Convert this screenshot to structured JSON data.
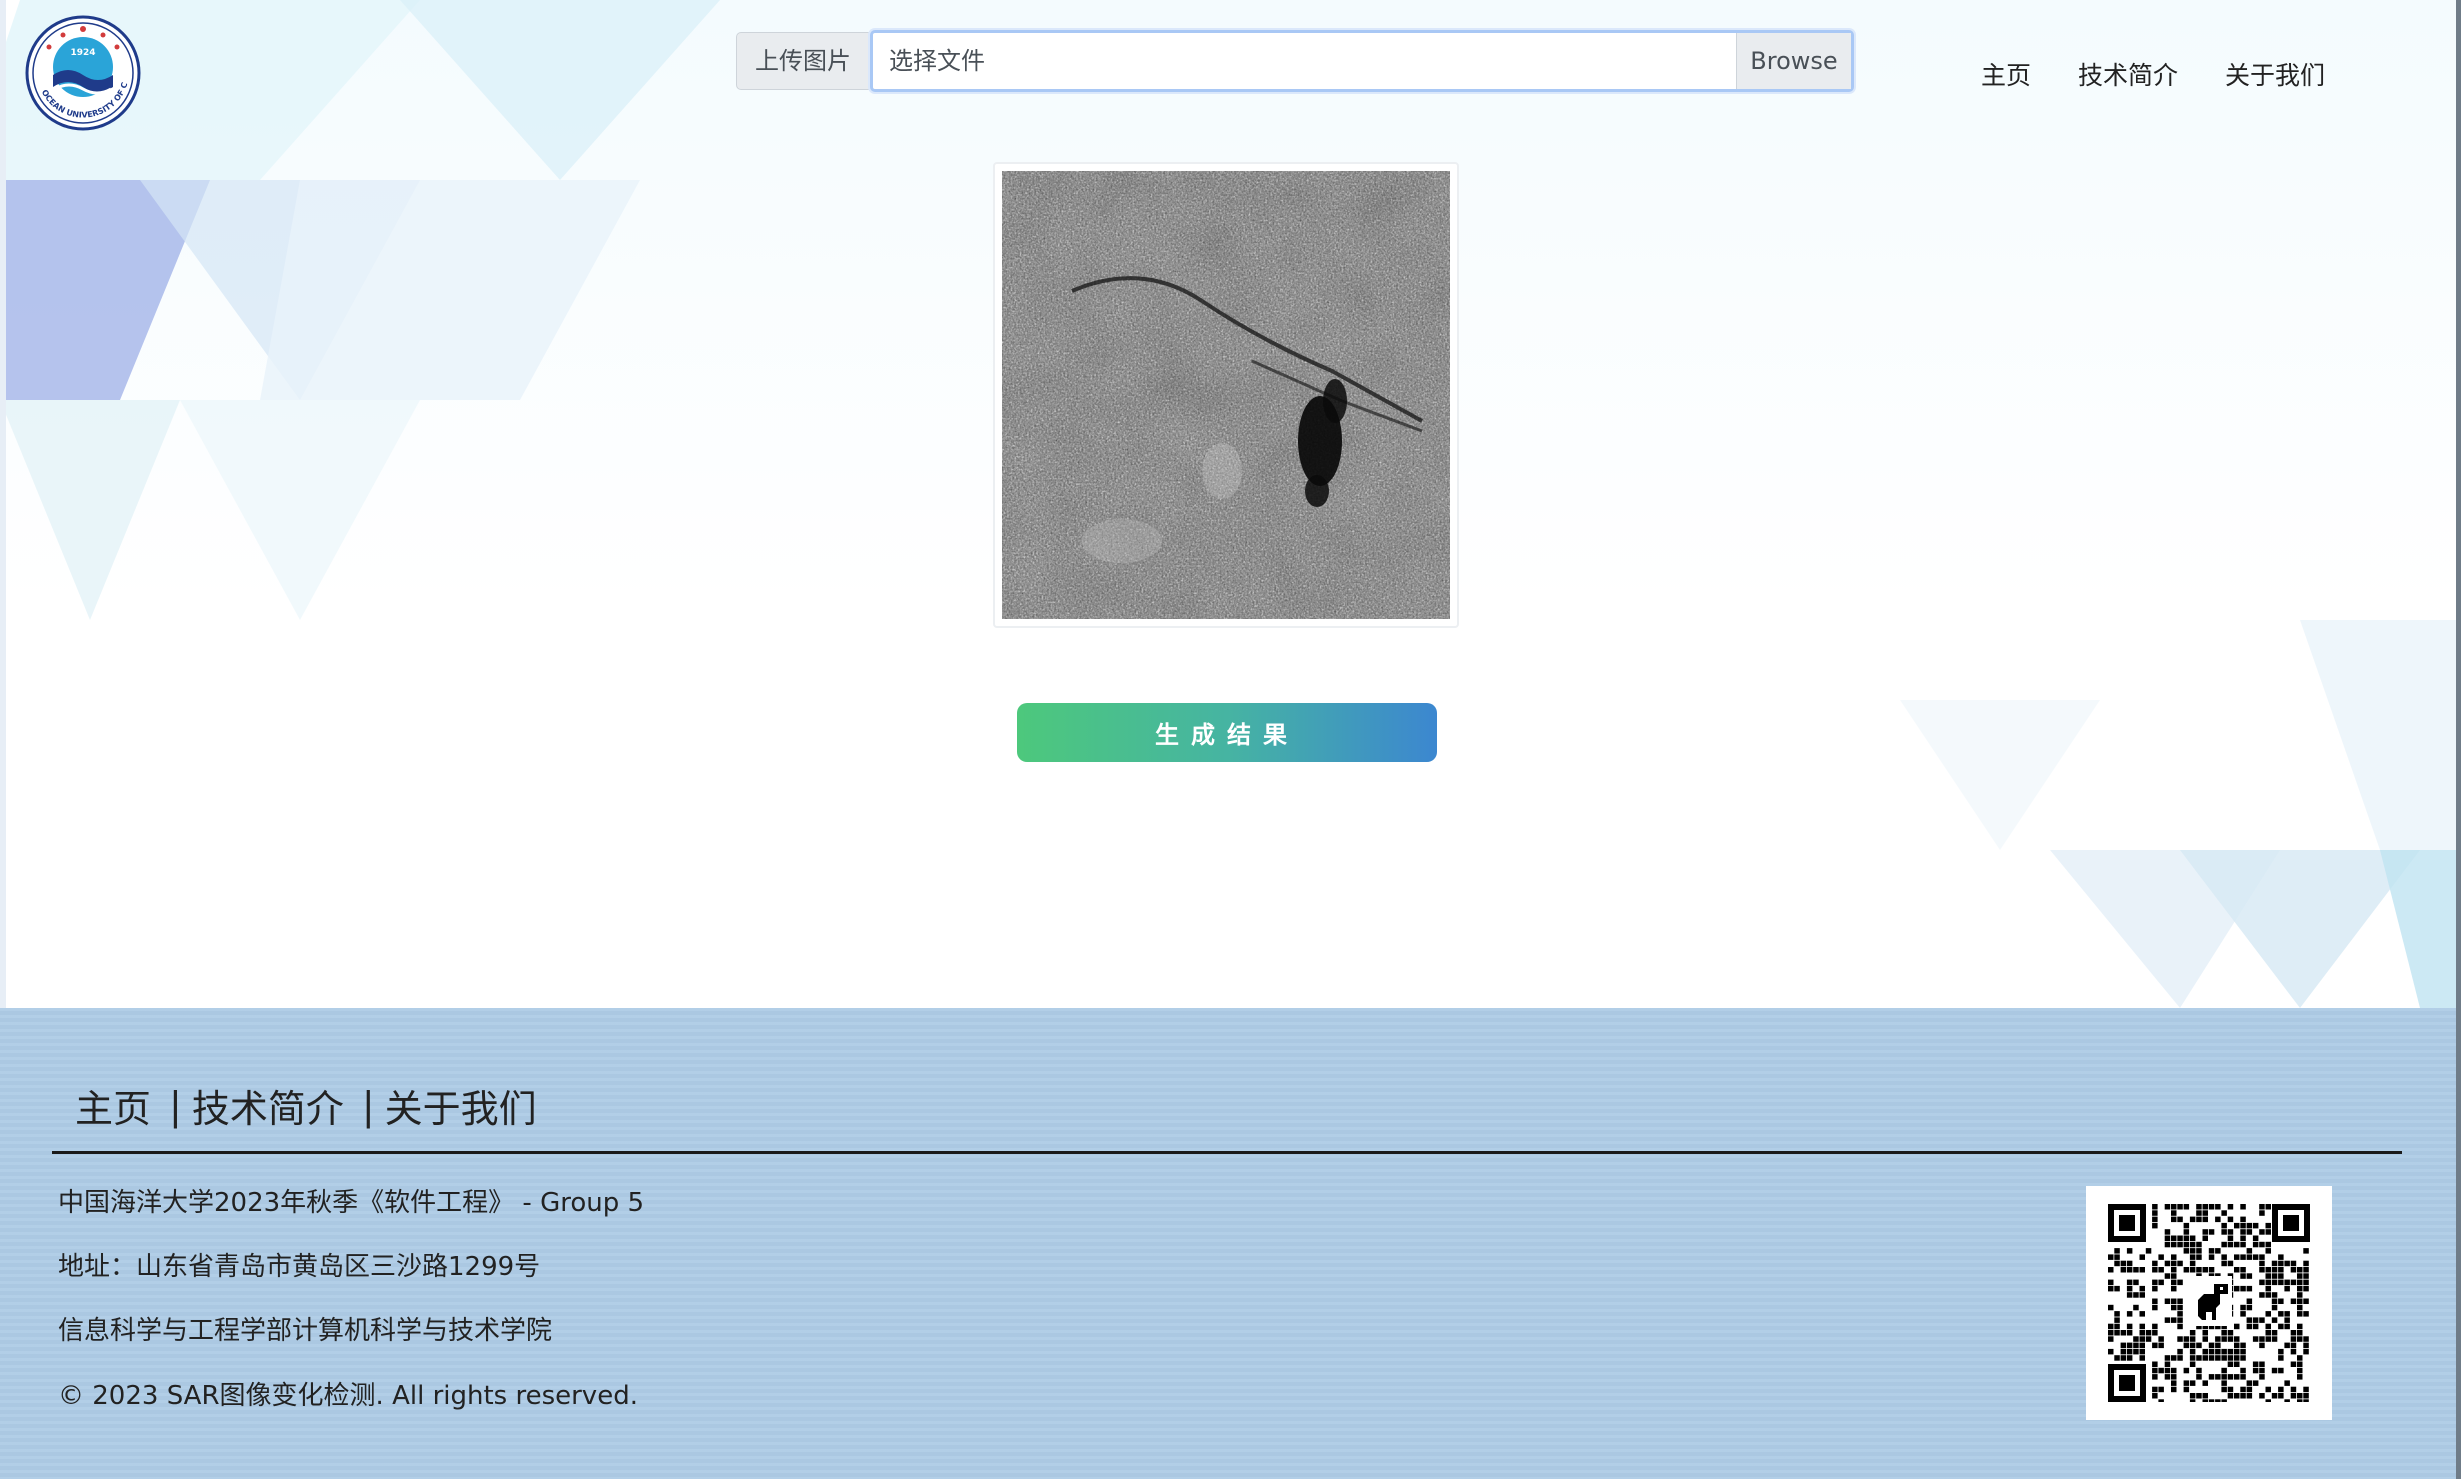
{
  "header": {
    "logo": {
      "icon": "ocean-university-seal-icon",
      "year": "1924",
      "motto_text": "OCEAN UNIVERSITY OF CHINA",
      "cn_text": "中国海洋大学"
    },
    "upload": {
      "label": "上传图片",
      "file_placeholder": "选择文件",
      "browse_label": "Browse"
    },
    "nav": [
      "主页",
      "技术简介",
      "关于我们"
    ]
  },
  "main": {
    "preview": {
      "icon": "sar-image-preview"
    },
    "generate_label": "生成结果"
  },
  "footer": {
    "nav": [
      "主页",
      "技术简介",
      "关于我们"
    ],
    "separator": "|",
    "lines": [
      "中国海洋大学2023年秋季《软件工程》 - Group 5",
      "地址：山东省青岛市黄岛区三沙路1299号",
      "信息科学与工程学部计算机科学与技术学院",
      "© 2023 SAR图像变化检测. All rights reserved."
    ],
    "qr": {
      "icon": "qr-code-dinosaur-icon"
    }
  },
  "colors": {
    "button_gradient_start": "#4dc87c",
    "button_gradient_end": "#3c87d0",
    "footer_bg": "#aecce6",
    "logo_blue": "#1f3b8a"
  }
}
